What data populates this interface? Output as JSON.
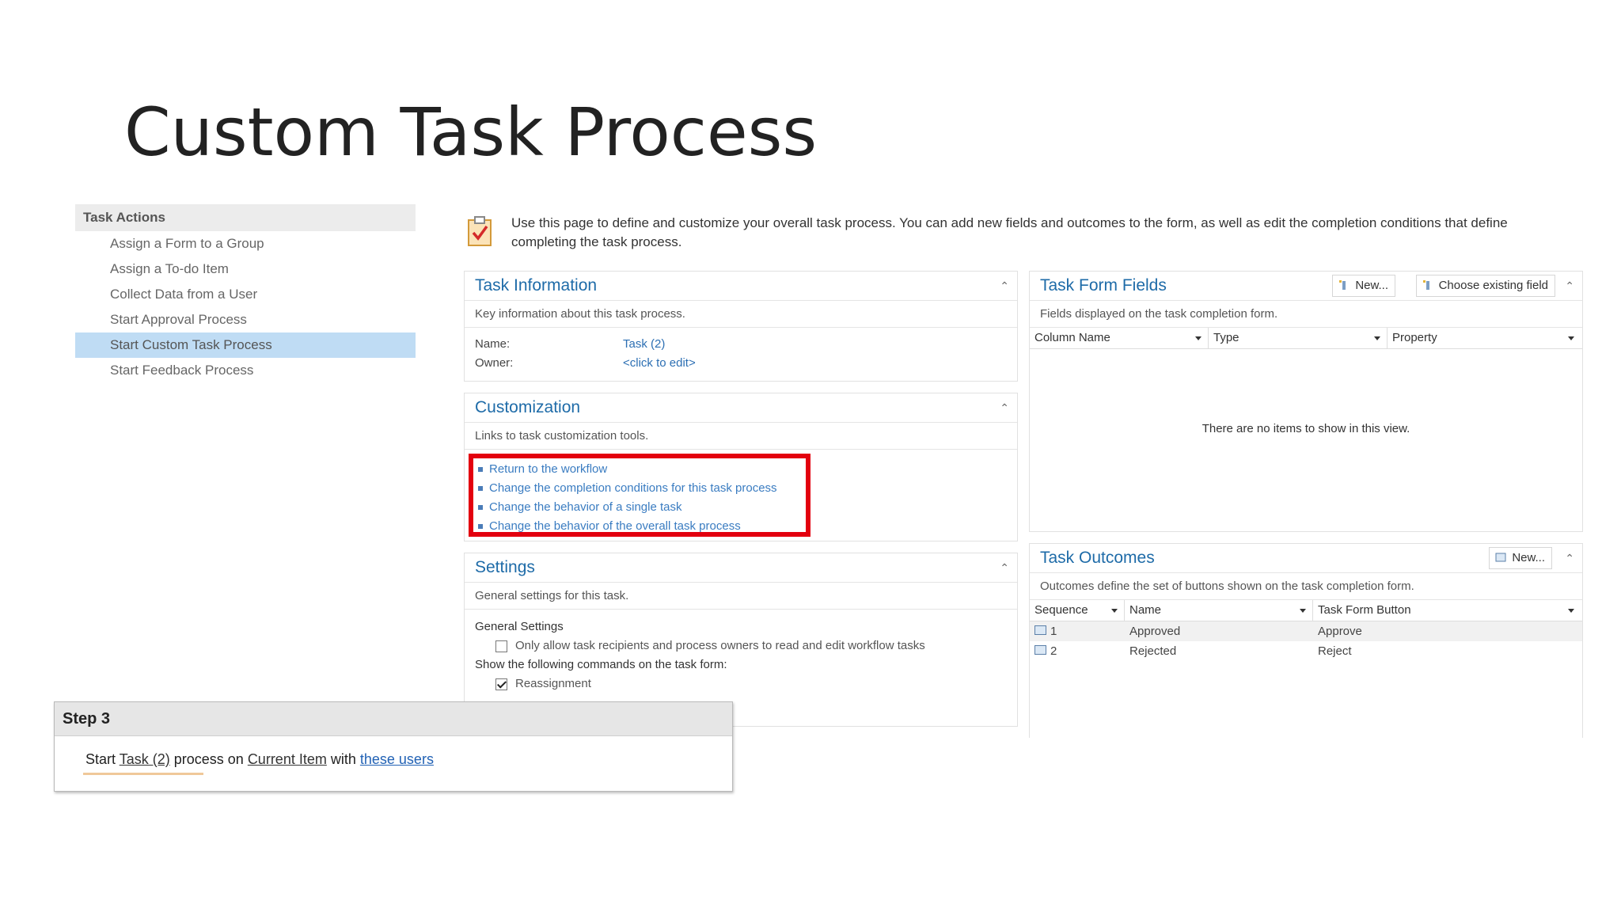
{
  "slide": {
    "title": "Custom Task Process"
  },
  "task_actions": {
    "header": "Task Actions",
    "items": [
      {
        "label": "Assign a Form to a Group",
        "selected": false
      },
      {
        "label": "Assign a To-do Item",
        "selected": false
      },
      {
        "label": "Collect Data from a User",
        "selected": false
      },
      {
        "label": "Start Approval Process",
        "selected": false
      },
      {
        "label": "Start Custom Task Process",
        "selected": true
      },
      {
        "label": "Start Feedback Process",
        "selected": false
      }
    ]
  },
  "intro": {
    "text": "Use this page to define and customize your overall task process. You can add new fields and outcomes to the form, as well as edit the completion conditions that define completing the task process."
  },
  "task_information": {
    "title": "Task Information",
    "description": "Key information about this task process.",
    "name_label": "Name:",
    "name_value": "Task (2)",
    "owner_label": "Owner:",
    "owner_value": "<click to edit>"
  },
  "customization": {
    "title": "Customization",
    "description": "Links to task customization tools.",
    "links": [
      "Return to the workflow",
      "Change the completion conditions for this task process",
      "Change the behavior of a single task",
      "Change the behavior of the overall task process"
    ]
  },
  "settings": {
    "title": "Settings",
    "description": "General settings for this task.",
    "general_label": "General Settings",
    "only_allow_label": "Only allow task recipients and process owners to read and edit workflow tasks",
    "only_allow_checked": false,
    "show_commands_label": "Show the following commands on the task form:",
    "reassignment_label": "Reassignment",
    "reassignment_checked": true
  },
  "task_form_fields": {
    "title": "Task Form Fields",
    "new_button": "New...",
    "choose_button": "Choose existing field",
    "description": "Fields displayed on the task completion form.",
    "columns": [
      "Column Name",
      "Type",
      "Property"
    ],
    "empty_text": "There are no items to show in this view."
  },
  "task_outcomes": {
    "title": "Task Outcomes",
    "new_button": "New...",
    "description": "Outcomes define the set of buttons shown on the task completion form.",
    "columns": [
      "Sequence",
      "Name",
      "Task Form Button"
    ],
    "rows": [
      {
        "sequence": "1",
        "name": "Approved",
        "button": "Approve"
      },
      {
        "sequence": "2",
        "name": "Rejected",
        "button": "Reject"
      }
    ]
  },
  "step3": {
    "title": "Step 3",
    "start": "Start",
    "task_link": "Task (2)",
    "process_on": "process on",
    "item_link": "Current Item",
    "with": "with",
    "users_link": "these users"
  },
  "colors": {
    "accent": "#1e6ba8",
    "highlight": "#e3000f",
    "selected": "#bfdcf4"
  }
}
